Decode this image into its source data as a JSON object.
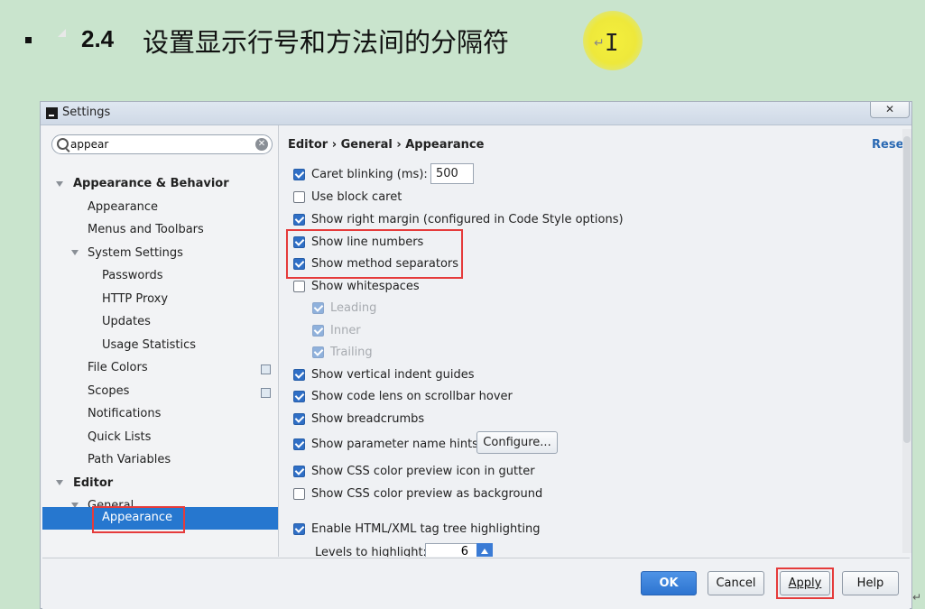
{
  "slide": {
    "heading_number": "2.4",
    "heading_text": "设置显示行号和方法间的分隔符",
    "return_mark": "↵"
  },
  "dialog": {
    "title": "Settings",
    "close_glyph": "✕"
  },
  "search": {
    "value": "appear"
  },
  "tree": {
    "appearance_behavior": "Appearance & Behavior",
    "appearance": "Appearance",
    "menus_toolbars": "Menus and Toolbars",
    "system_settings": "System Settings",
    "passwords": "Passwords",
    "http_proxy": "HTTP Proxy",
    "updates": "Updates",
    "usage_statistics": "Usage Statistics",
    "file_colors": "File Colors",
    "scopes": "Scopes",
    "notifications": "Notifications",
    "quick_lists": "Quick Lists",
    "path_variables": "Path Variables",
    "editor": "Editor",
    "general": "General",
    "editor_appearance": "Appearance"
  },
  "content": {
    "breadcrumb": "Editor › General › Appearance",
    "reset": "Reset",
    "caret_blinking": "Caret blinking (ms):",
    "caret_blinking_value": "500",
    "use_block_caret": "Use block caret",
    "show_right_margin": "Show right margin (configured in Code Style options)",
    "show_line_numbers": "Show line numbers",
    "show_method_separators": "Show method separators",
    "show_whitespaces": "Show whitespaces",
    "leading": "Leading",
    "inner": "Inner",
    "trailing": "Trailing",
    "show_indent_guides": "Show vertical indent guides",
    "show_code_lens": "Show code lens on scrollbar hover",
    "show_breadcrumbs": "Show breadcrumbs",
    "show_param_hints": "Show parameter name hints",
    "configure": "Configure...",
    "show_css_gutter": "Show CSS color preview icon in gutter",
    "show_css_background": "Show CSS color preview as background",
    "enable_tag_highlight": "Enable HTML/XML tag tree highlighting",
    "levels_to_highlight": "Levels to highlight:",
    "levels_value": "6"
  },
  "footer": {
    "ok": "OK",
    "cancel": "Cancel",
    "apply": "Apply",
    "help": "Help"
  },
  "colors": {
    "slide_background": "#c9e4cd",
    "selection": "#2677cf",
    "highlight_box": "#e53b3b",
    "cursor_halo": "#eee83b"
  }
}
